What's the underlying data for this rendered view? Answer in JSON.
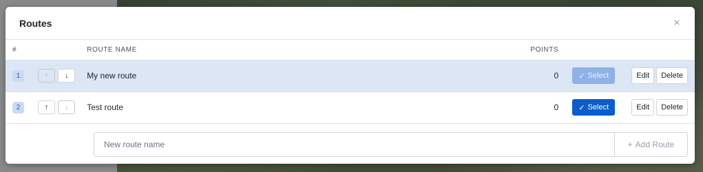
{
  "modal": {
    "title": "Routes",
    "close_icon": "×"
  },
  "table": {
    "headers": {
      "num": "#",
      "route_name": "ROUTE NAME",
      "points": "POINTS"
    },
    "rows": [
      {
        "index": "1",
        "up_icon": "↑",
        "down_icon": "↓",
        "name": "My new route",
        "points": "0",
        "select_label": "Select",
        "check_icon": "✓",
        "edit_label": "Edit",
        "delete_label": "Delete",
        "selected": true
      },
      {
        "index": "2",
        "up_icon": "↑",
        "down_icon": "↓",
        "name": "Test route",
        "points": "0",
        "select_label": "Select",
        "check_icon": "✓",
        "edit_label": "Edit",
        "delete_label": "Delete",
        "selected": false
      }
    ]
  },
  "add_form": {
    "placeholder": "New route name",
    "value": "",
    "button_label": "Add Route",
    "plus_icon": "+"
  },
  "colors": {
    "primary": "#0b5ccc",
    "primary_disabled": "#8fb1e6",
    "selected_row": "#dce6f4",
    "badge_bg": "#c9daf3"
  }
}
